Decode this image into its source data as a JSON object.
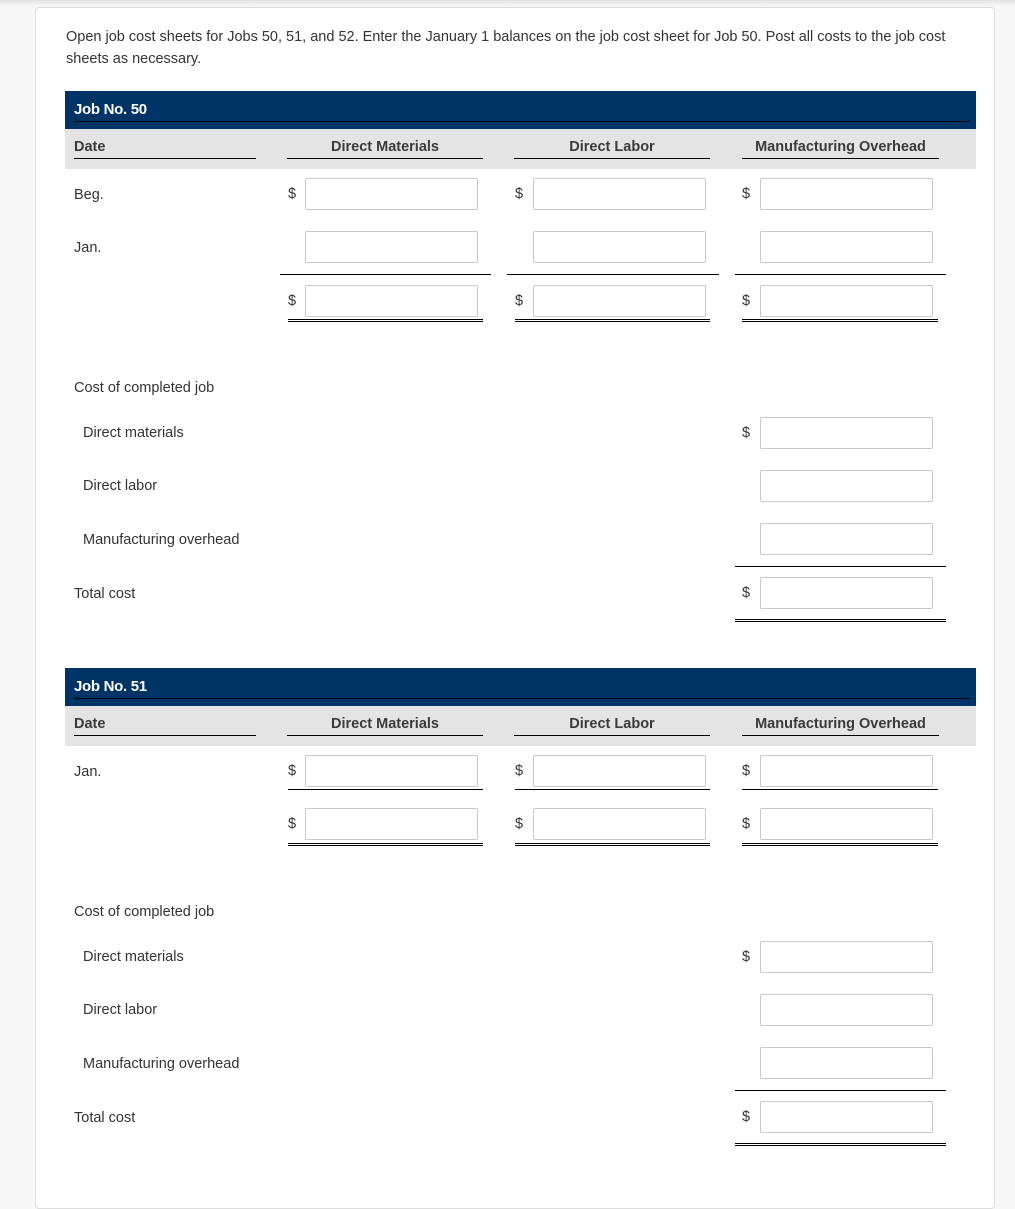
{
  "instructions": "Open job cost sheets for Jobs 50, 51, and 52. Enter the January 1 balances on the job cost sheet for Job 50. Post all costs to the job cost sheets as necessary.",
  "currency_symbol": "$",
  "columns": {
    "date": "Date",
    "direct_materials": "Direct Materials",
    "direct_labor": "Direct Labor",
    "manufacturing_overhead": "Manufacturing Overhead"
  },
  "jobs": [
    {
      "title": "Job No. 50",
      "rows": {
        "beg": "Beg.",
        "jan": "Jan."
      },
      "summary": {
        "heading": "Cost of completed job",
        "direct_materials": "Direct materials",
        "direct_labor": "Direct labor",
        "manufacturing_overhead": "Manufacturing overhead",
        "total": "Total cost"
      },
      "values": {
        "beg_dm": "",
        "beg_dl": "",
        "beg_mo": "",
        "jan_dm": "",
        "jan_dl": "",
        "jan_mo": "",
        "tot_dm": "",
        "tot_dl": "",
        "tot_mo": "",
        "sum_dm": "",
        "sum_dl": "",
        "sum_mo": "",
        "sum_total": ""
      }
    },
    {
      "title": "Job No. 51",
      "rows": {
        "jan": "Jan."
      },
      "summary": {
        "heading": "Cost of completed job",
        "direct_materials": "Direct materials",
        "direct_labor": "Direct labor",
        "manufacturing_overhead": "Manufacturing overhead",
        "total": "Total cost"
      },
      "values": {
        "jan_dm": "",
        "jan_dl": "",
        "jan_mo": "",
        "tot_dm": "",
        "tot_dl": "",
        "tot_mo": "",
        "sum_dm": "",
        "sum_dl": "",
        "sum_mo": "",
        "sum_total": ""
      }
    }
  ]
}
